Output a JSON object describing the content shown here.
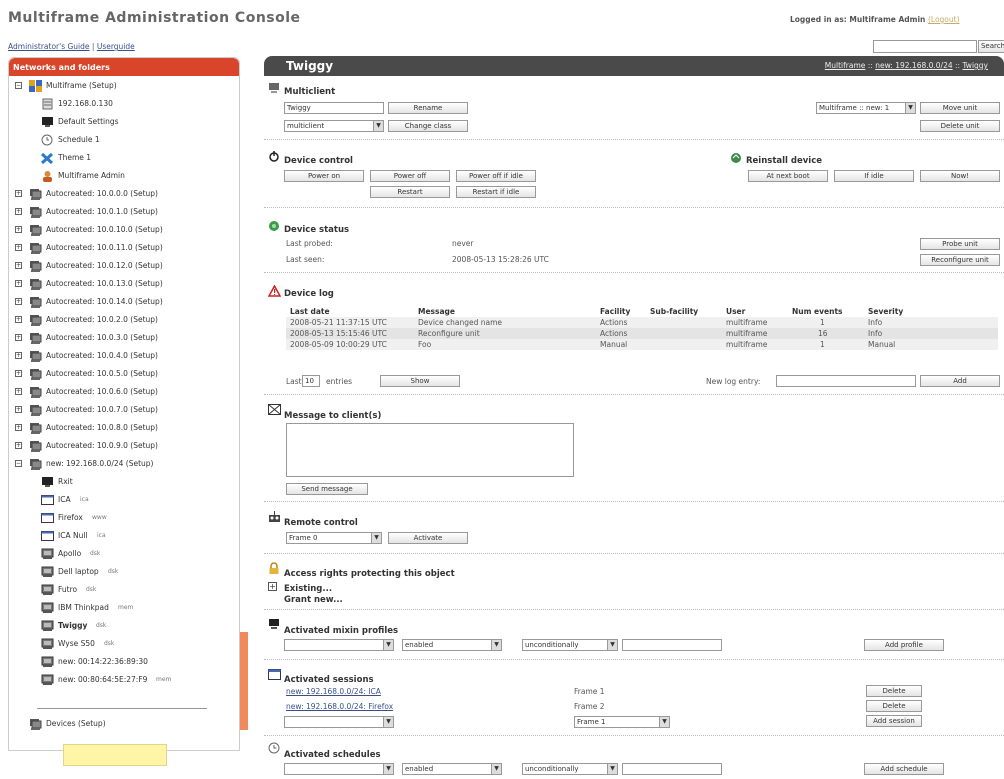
{
  "app": {
    "title": "Multiframe Administration Console",
    "logged_in": "Logged in as: Multiframe Admin",
    "logout": "(Logout)"
  },
  "toplinks": {
    "guide": "Administrator's Guide",
    "sep": "|",
    "userguide": "Userguide"
  },
  "search": {
    "value": "",
    "button": "Search"
  },
  "sidebar": {
    "title": "Networks and folders",
    "items": [
      {
        "label": "Multiframe  (Setup)",
        "icon": "network-root-icon"
      },
      {
        "label": "192.168.0.130",
        "icon": "server-icon"
      },
      {
        "label": "Default Settings",
        "icon": "settings-icon"
      },
      {
        "label": "Schedule 1",
        "icon": "clock-icon"
      },
      {
        "label": "Theme 1",
        "icon": "theme-icon"
      },
      {
        "label": "Multiframe Admin",
        "icon": "user-icon"
      },
      {
        "label": "Autocreated: 10.0.0.0  (Setup)",
        "icon": "folder-network-icon"
      },
      {
        "label": "Autocreated: 10.0.1.0  (Setup)",
        "icon": "folder-network-icon"
      },
      {
        "label": "Autocreated: 10.0.10.0  (Setup)",
        "icon": "folder-network-icon"
      },
      {
        "label": "Autocreated: 10.0.11.0  (Setup)",
        "icon": "folder-network-icon"
      },
      {
        "label": "Autocreated: 10.0.12.0  (Setup)",
        "icon": "folder-network-icon"
      },
      {
        "label": "Autocreated: 10.0.13.0  (Setup)",
        "icon": "folder-network-icon"
      },
      {
        "label": "Autocreated: 10.0.14.0  (Setup)",
        "icon": "folder-network-icon"
      },
      {
        "label": "Autocreated: 10.0.2.0  (Setup)",
        "icon": "folder-network-icon"
      },
      {
        "label": "Autocreated: 10.0.3.0  (Setup)",
        "icon": "folder-network-icon"
      },
      {
        "label": "Autocreated: 10.0.4.0  (Setup)",
        "icon": "folder-network-icon"
      },
      {
        "label": "Autocreated: 10.0.5.0  (Setup)",
        "icon": "folder-network-icon"
      },
      {
        "label": "Autocreated: 10.0.6.0  (Setup)",
        "icon": "folder-network-icon"
      },
      {
        "label": "Autocreated: 10.0.7.0  (Setup)",
        "icon": "folder-network-icon"
      },
      {
        "label": "Autocreated: 10.0.8.0  (Setup)",
        "icon": "folder-network-icon"
      },
      {
        "label": "Autocreated: 10.0.9.0  (Setup)",
        "icon": "folder-network-icon"
      },
      {
        "label": "new: 192.168.0.0/24  (Setup)",
        "icon": "folder-network-icon"
      },
      {
        "label": "Rxit",
        "icon": "settings-icon"
      },
      {
        "label": "ICA",
        "suffix": "ica",
        "icon": "session-window-icon"
      },
      {
        "label": "Firefox",
        "suffix": "www",
        "icon": "session-window-icon"
      },
      {
        "label": "ICA Null",
        "suffix": "ica",
        "icon": "session-window-icon"
      },
      {
        "label": "Apollo",
        "suffix": "dsk",
        "icon": "device-icon"
      },
      {
        "label": "Dell laptop",
        "suffix": "dsk",
        "icon": "device-icon"
      },
      {
        "label": "Futro",
        "suffix": "dsk",
        "icon": "device-icon"
      },
      {
        "label": "IBM Thinkpad",
        "suffix": "mem",
        "icon": "device-icon"
      },
      {
        "label": "Twiggy",
        "suffix": "dsk",
        "icon": "device-icon"
      },
      {
        "label": "Wyse S50",
        "suffix": "dsk",
        "icon": "device-icon"
      },
      {
        "label": "new: 00:14:22:36:89:30",
        "icon": "device-icon"
      },
      {
        "label": "new: 00:80:64:5E:27:F9",
        "suffix": "mem",
        "icon": "device-icon"
      },
      {
        "label": "Devices  (Setup)",
        "icon": "folder-network-icon"
      }
    ]
  },
  "page": {
    "title": "Twiggy",
    "breadcrumb": [
      "Multiframe",
      "new: 192.168.0.0/24",
      "Twiggy"
    ],
    "breadcrumb_sep": "::"
  },
  "multiclient": {
    "title": "Multiclient",
    "name_value": "Twiggy",
    "rename": "Rename",
    "class_value": "multiclient",
    "change_class": "Change class",
    "move_select": "Multiframe :: new: 1",
    "move_unit": "Move unit",
    "delete_unit": "Delete unit"
  },
  "device_control": {
    "title": "Device control",
    "power_on": "Power on",
    "power_off": "Power off",
    "power_off_idle": "Power off if idle",
    "restart": "Restart",
    "restart_idle": "Restart if idle"
  },
  "reinstall": {
    "title": "Reinstall device",
    "next_boot": "At next boot",
    "if_idle": "If idle",
    "now": "Now!"
  },
  "device_status": {
    "title": "Device status",
    "last_probed_label": "Last probed:",
    "last_probed_value": "never",
    "last_seen_label": "Last seen:",
    "last_seen_value": "2008-05-13 15:28:26 UTC",
    "probe": "Probe unit",
    "reconfigure": "Reconfigure unit"
  },
  "device_log": {
    "title": "Device log",
    "columns": [
      "Last date",
      "Message",
      "Facility",
      "Sub-facility",
      "User",
      "Num events",
      "Severity"
    ],
    "rows": [
      [
        "2008-05-21 11:37:15 UTC",
        "Device changed name",
        "Actions",
        "",
        "multiframe",
        "1",
        "Info"
      ],
      [
        "2008-05-13 15:15:46 UTC",
        "Reconfigure unit",
        "Actions",
        "",
        "multiframe",
        "16",
        "Info"
      ],
      [
        "2008-05-09 10:00:29 UTC",
        "Foo",
        "Manual",
        "",
        "multiframe",
        "1",
        "Manual"
      ]
    ],
    "last_label": "Last",
    "last_value": "10",
    "entries_label": "entries",
    "show": "Show",
    "new_entry_label": "New log entry:",
    "add": "Add"
  },
  "message": {
    "title": "Message to client(s)",
    "send": "Send message"
  },
  "remote": {
    "title": "Remote control",
    "frame_value": "Frame 0",
    "activate": "Activate"
  },
  "access": {
    "title": "Access rights protecting this object",
    "existing": "Existing...",
    "grant": "Grant new..."
  },
  "mixin": {
    "title": "Activated mixin profiles",
    "state": "enabled",
    "condition": "unconditionally",
    "add": "Add profile"
  },
  "sessions": {
    "title": "Activated sessions",
    "items": [
      {
        "link": "new: 192.168.0.0/24: ICA",
        "frame": "Frame 1",
        "action": "Delete"
      },
      {
        "link": "new: 192.168.0.0/24: Firefox",
        "frame": "Frame 2",
        "action": "Delete"
      }
    ],
    "frame_select": "Frame 1",
    "add": "Add session"
  },
  "schedules": {
    "title": "Activated schedules",
    "state": "enabled",
    "condition": "unconditionally",
    "add": "Add schedule"
  },
  "colors": {
    "sidebar_header": "#d9452b",
    "title_bar": "#4a4a4a",
    "link": "#3a4f8a"
  }
}
